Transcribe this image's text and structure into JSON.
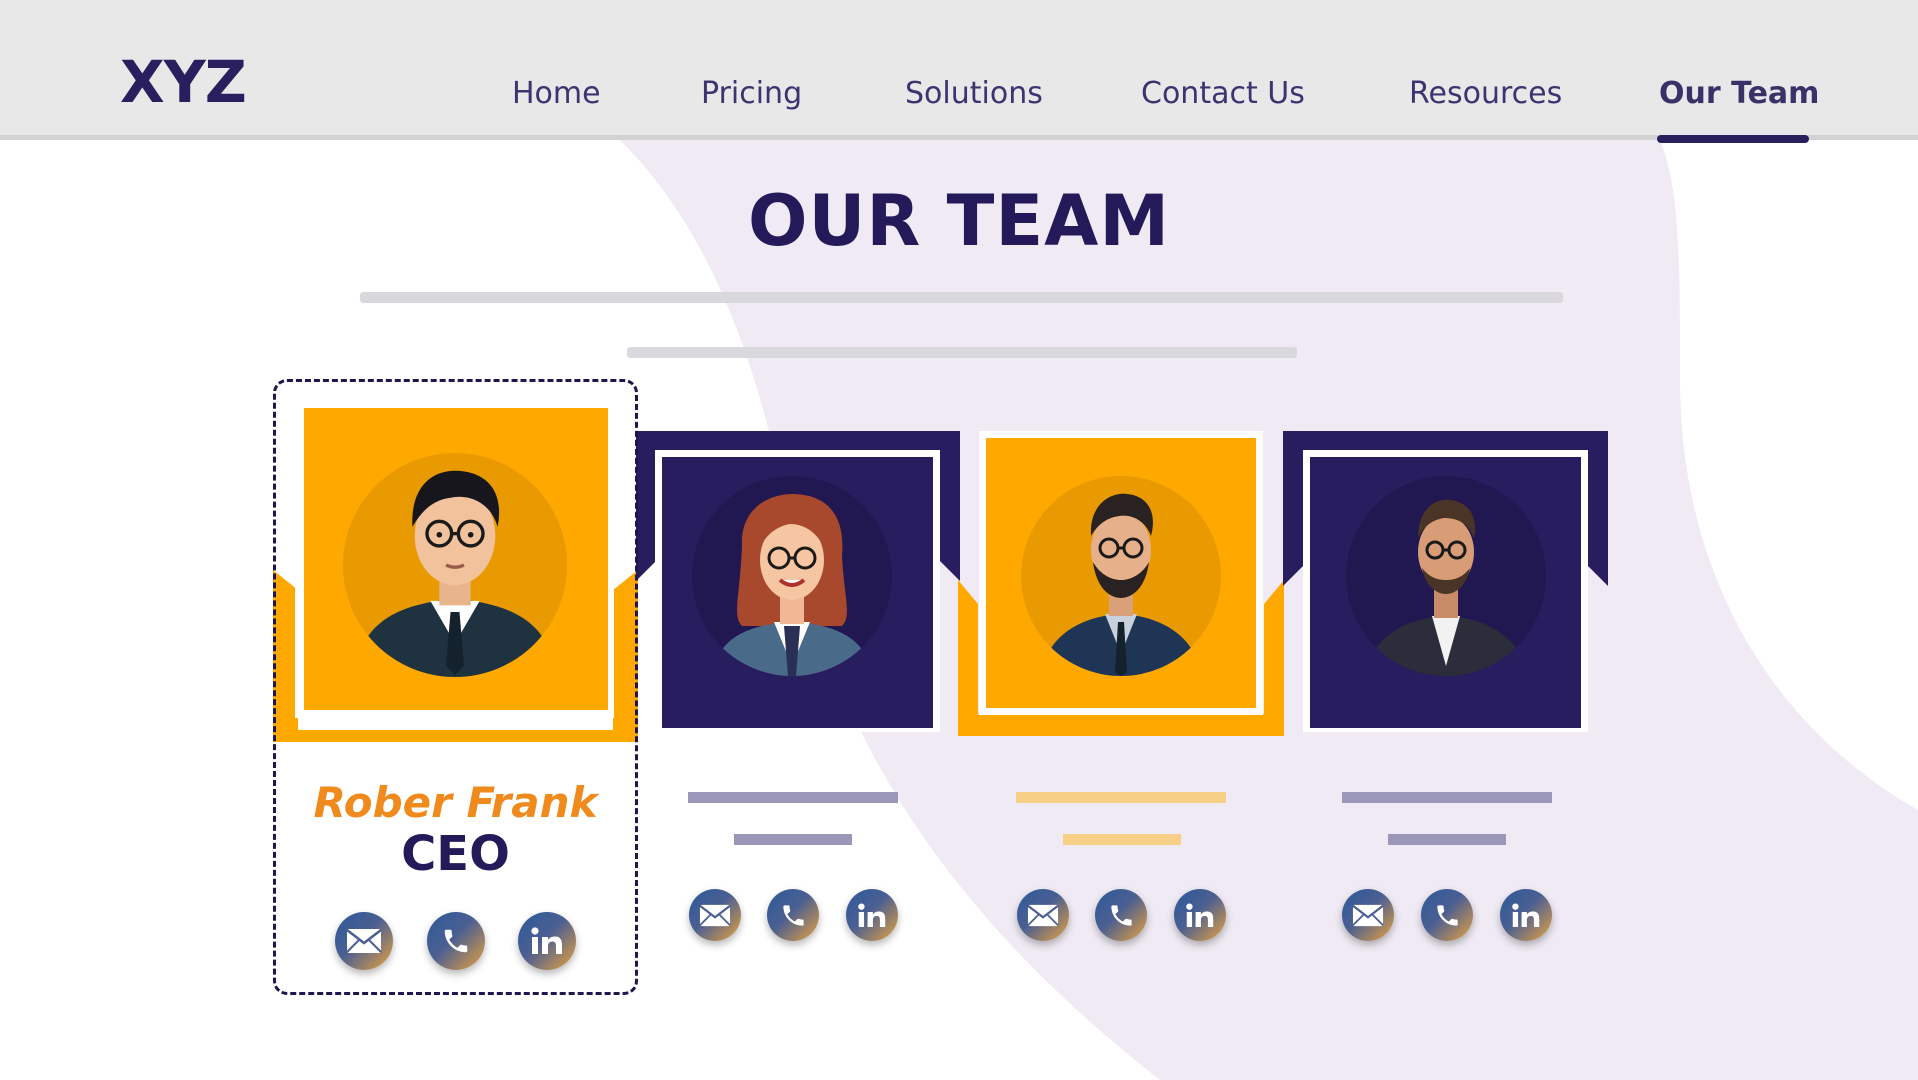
{
  "header": {
    "logo": "XYZ",
    "nav": [
      {
        "label": "Home",
        "active": false
      },
      {
        "label": "Pricing",
        "active": false
      },
      {
        "label": "Solutions",
        "active": false
      },
      {
        "label": "Contact Us",
        "active": false
      },
      {
        "label": "Resources",
        "active": false
      },
      {
        "label": "Our Team",
        "active": true
      }
    ]
  },
  "main": {
    "title": "OUR TEAM",
    "team": [
      {
        "name": "Rober Frank",
        "role": "CEO",
        "accent": "#ffa800",
        "selected": true,
        "icons": [
          "mail-icon",
          "phone-icon",
          "linkedin-icon"
        ]
      },
      {
        "name": "",
        "role": "",
        "accent": "#281d5e",
        "selected": false,
        "icons": [
          "mail-icon",
          "phone-icon",
          "linkedin-icon"
        ]
      },
      {
        "name": "",
        "role": "",
        "accent": "#ffa800",
        "selected": false,
        "icons": [
          "mail-icon",
          "phone-icon",
          "linkedin-icon"
        ]
      },
      {
        "name": "",
        "role": "",
        "accent": "#281d5e",
        "selected": false,
        "icons": [
          "mail-icon",
          "phone-icon",
          "linkedin-icon"
        ]
      }
    ]
  },
  "colors": {
    "navy": "#281d5e",
    "orange": "#ffa800",
    "name_orange": "#f08a1c",
    "lavender": "#efeaf3"
  }
}
